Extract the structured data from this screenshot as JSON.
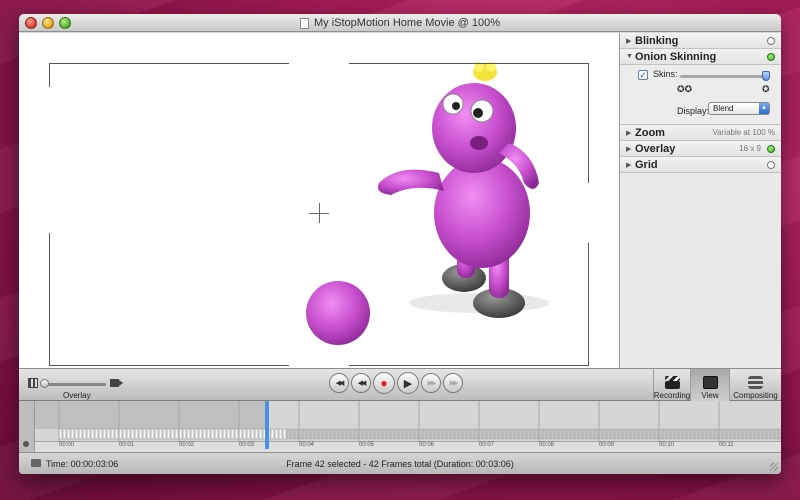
{
  "window": {
    "title": "My iStopMotion Home Movie @ 100%"
  },
  "inspector": {
    "sections": [
      {
        "label": "Blinking",
        "expanded": false,
        "enabled": false
      },
      {
        "label": "Onion Skinning",
        "expanded": true,
        "enabled": true
      },
      {
        "label": "Zoom",
        "expanded": false,
        "info": "Variable at 100 %"
      },
      {
        "label": "Overlay",
        "expanded": false,
        "info": "16 x 9",
        "enabled": true
      },
      {
        "label": "Grid",
        "expanded": false,
        "enabled": false
      }
    ],
    "onion": {
      "skins_checked": true,
      "skins_label": "Skins:",
      "display_label": "Display:",
      "display_value": "Blend"
    }
  },
  "controlbar": {
    "overlay_label": "Overlay",
    "modes": [
      {
        "label": "Recording",
        "icon": "clapperboard-icon",
        "active": false
      },
      {
        "label": "View",
        "icon": "view-icon",
        "active": true
      },
      {
        "label": "Compositing",
        "icon": "layers-icon",
        "active": false
      }
    ]
  },
  "timeline": {
    "ticks": [
      "00:00",
      "00:01",
      "00:02",
      "00:03",
      "00:04",
      "00:05",
      "00:06",
      "00:07",
      "00:08",
      "00:09",
      "00:10",
      "00:11"
    ]
  },
  "statusbar": {
    "time": "Time: 00:00:03:06",
    "message": "Frame 42 selected - 42 Frames total (Duration: 00:03:06)"
  },
  "colors": {
    "accent": "#4a8fe0",
    "record": "#e02020",
    "enabled_dot": "#3aa82a"
  }
}
